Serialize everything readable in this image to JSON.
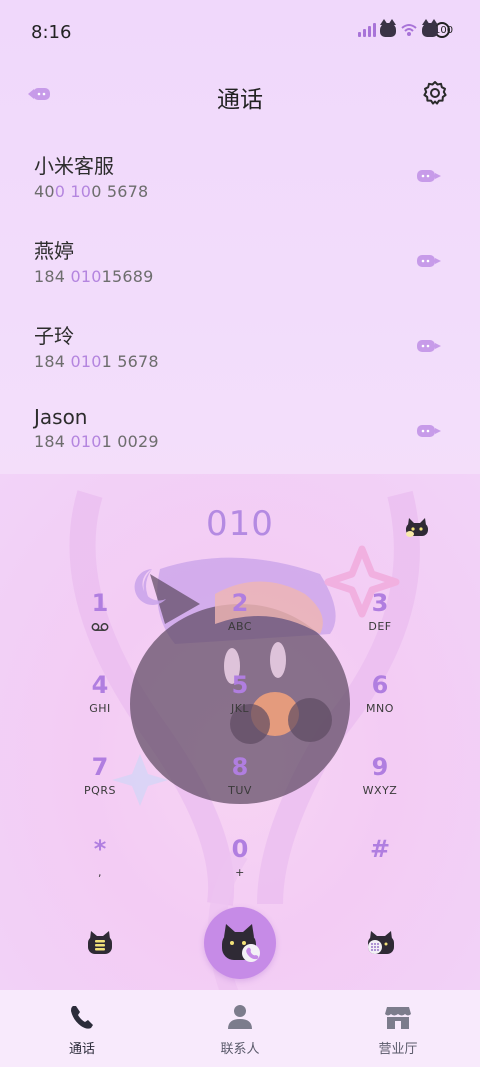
{
  "status_bar": {
    "time": "8:16",
    "battery": "100",
    "icons": [
      "signal-icon",
      "cat-sticker-icon",
      "wifi-icon",
      "battery-icon"
    ]
  },
  "header": {
    "title": "通话",
    "icons": [
      "back-icon",
      "gear-icon"
    ]
  },
  "calls": [
    {
      "name": "小米客服",
      "number_parts": [
        "40",
        "0 10",
        "0 5678"
      ]
    },
    {
      "name": "燕婷",
      "number_parts": [
        "184 ",
        "010",
        "15689"
      ]
    },
    {
      "name": "子玲",
      "number_parts": [
        "184 ",
        "010",
        "1 5678"
      ]
    },
    {
      "name": "Jason",
      "number_parts": [
        "184 ",
        "010",
        "1 0029"
      ]
    }
  ],
  "dialer": {
    "input": "010",
    "keys": [
      {
        "digit": "1",
        "sub": "voicemail-icon"
      },
      {
        "digit": "2",
        "sub": "ABC"
      },
      {
        "digit": "3",
        "sub": "DEF"
      },
      {
        "digit": "4",
        "sub": "GHI"
      },
      {
        "digit": "5",
        "sub": "JKL"
      },
      {
        "digit": "6",
        "sub": "MNO"
      },
      {
        "digit": "7",
        "sub": "PQRS"
      },
      {
        "digit": "8",
        "sub": "TUV"
      },
      {
        "digit": "9",
        "sub": "WXYZ"
      },
      {
        "digit": "*",
        "sub": ","
      },
      {
        "digit": "0",
        "sub": "+"
      },
      {
        "digit": "#",
        "sub": ""
      }
    ]
  },
  "tabs": [
    {
      "label": "通话",
      "icon": "phone-icon",
      "active": true
    },
    {
      "label": "联系人",
      "icon": "person-icon",
      "active": false
    },
    {
      "label": "营业厅",
      "icon": "store-icon",
      "active": false
    }
  ],
  "colors": {
    "accent": "#b07ee0",
    "highlight": "#b485df",
    "call_button": "#c68be7",
    "background": "#f0d8fb"
  }
}
